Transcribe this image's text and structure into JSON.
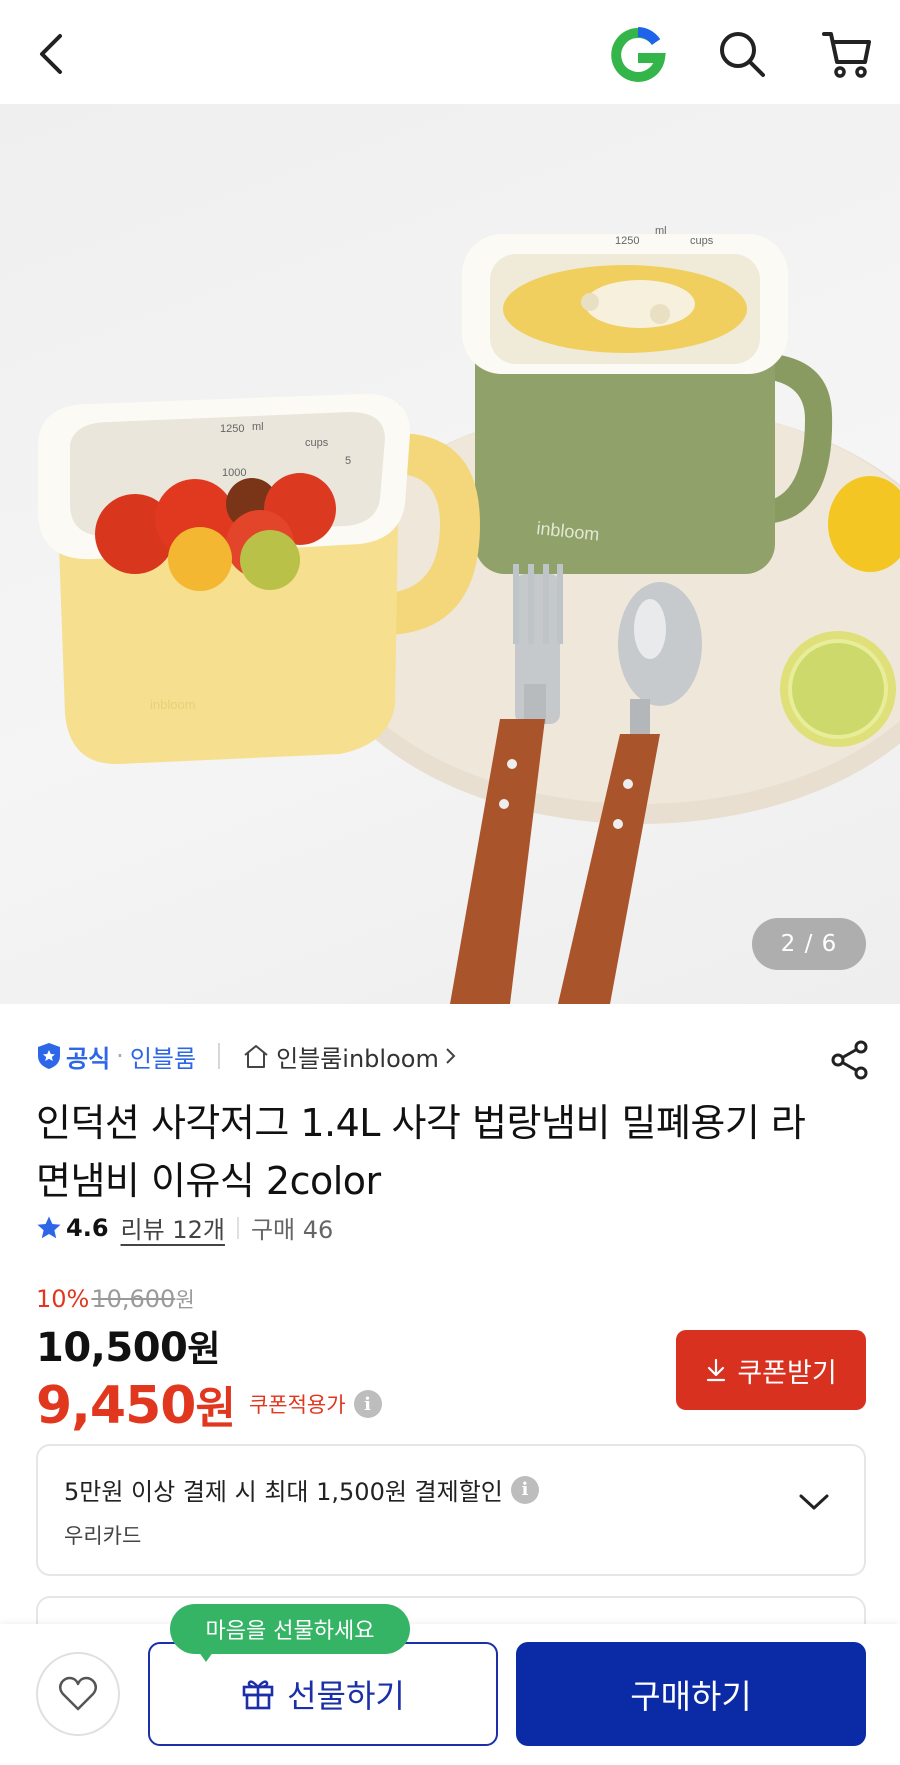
{
  "header": {
    "back_icon": "chevron-left-icon",
    "logo_icon": "g-logo-icon",
    "search_icon": "search-icon",
    "cart_icon": "cart-icon"
  },
  "gallery": {
    "counter": "2 / 6",
    "mug_text": "inbloom",
    "scale_ml": "ml",
    "scale_cups": "cups",
    "scale_1250": "1250",
    "scale_1000": "1000",
    "scale_5": "5"
  },
  "product": {
    "official_label": "공식",
    "brand": "인블룸",
    "store": "인블룸inbloom",
    "title": "인덕션 사각저그 1.4L 사각 법랑냄비 밀폐용기 라면냄비 이유식 2color",
    "rating": "4.6",
    "reviews": "리뷰 12개",
    "purchases": "구매 46"
  },
  "price": {
    "discount_rate": "10%",
    "original": "10,600",
    "original_unit": "원",
    "sale": "10,500",
    "sale_unit": "원",
    "coupon_price": "9,450",
    "coupon_unit": "원",
    "coupon_applied": "쿠폰적용가",
    "coupon_button": "쿠폰받기"
  },
  "card_benefit": {
    "main": "5만원 이상 결제 시 최대 1,500원 결제할인",
    "sub": "우리카드"
  },
  "bottom_bar": {
    "tooltip": "마음을 선물하세요",
    "gift_button": "선물하기",
    "buy_button": "구매하기"
  },
  "colors": {
    "accent_red": "#d9311f",
    "brand_blue": "#0a2aa6",
    "official_blue": "#2d67e8",
    "tooltip_green": "#35b466"
  }
}
